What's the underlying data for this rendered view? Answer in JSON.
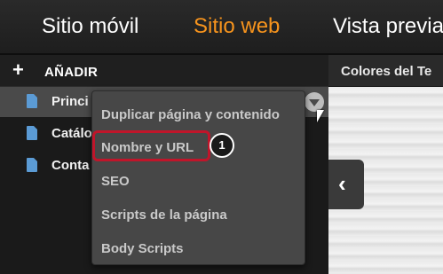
{
  "tabs": [
    {
      "label": "Sitio móvil",
      "active": false
    },
    {
      "label": "Sitio web",
      "active": true
    },
    {
      "label": "Vista previa",
      "active": false
    }
  ],
  "accent_color": "#f7941d",
  "sidebar": {
    "add_label": "AÑADIR",
    "add_icon": "plus-icon",
    "pages": [
      {
        "label": "Princi",
        "icon": "document-icon",
        "selected": true
      },
      {
        "label": "Catálo",
        "icon": "document-icon",
        "selected": false
      },
      {
        "label": "Conta",
        "icon": "document-icon",
        "selected": false
      }
    ]
  },
  "right_panel": {
    "header": "Colores del Te",
    "collapse_icon": "chevron-left-icon"
  },
  "context_menu": {
    "items": [
      {
        "label": "Duplicar página y contenido"
      },
      {
        "label": "Nombre y URL",
        "highlighted": true
      },
      {
        "label": "SEO"
      },
      {
        "label": "Scripts de la página"
      },
      {
        "label": "Body Scripts"
      }
    ]
  },
  "callout": {
    "number": "1",
    "color": "#c0152a"
  }
}
